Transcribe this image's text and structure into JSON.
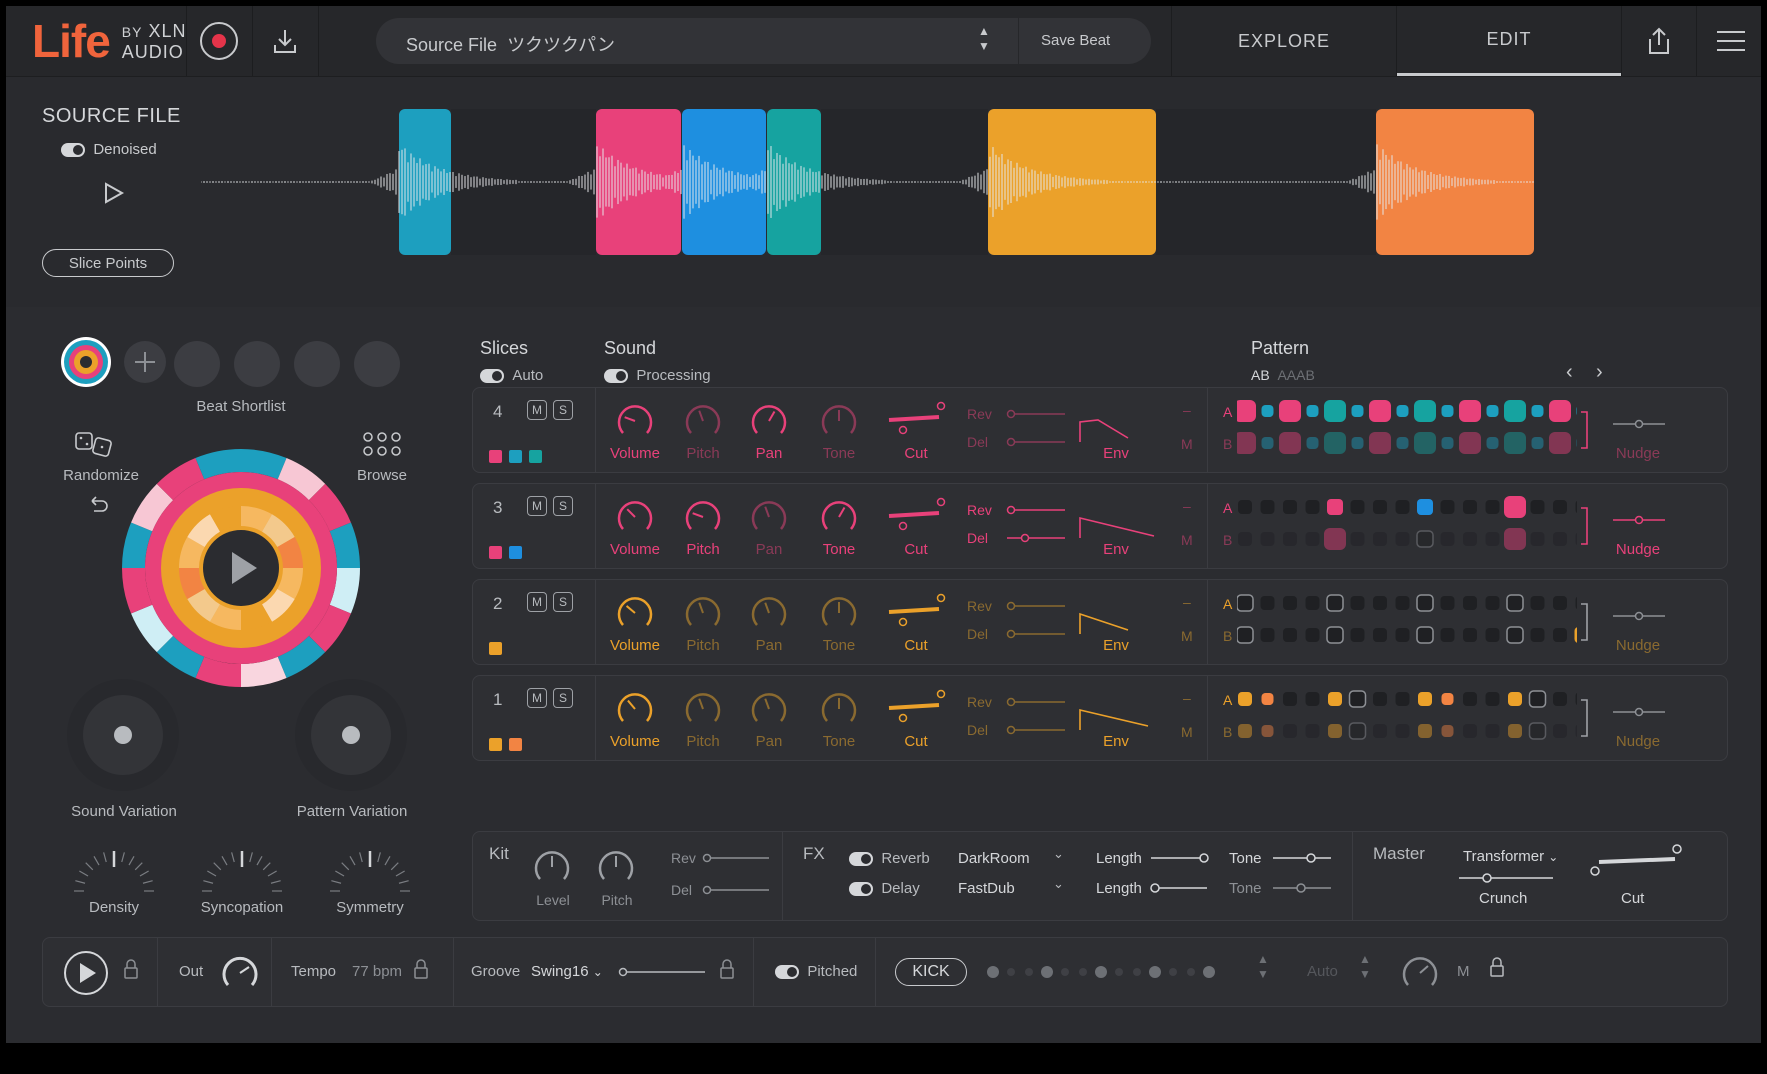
{
  "topbar": {
    "logo_text": "Life",
    "logo_by": "BY",
    "logo_xln": "XLN",
    "logo_audio": "AUDIO",
    "source_label": "Source File",
    "source_name": "ツクツクパン",
    "save_beat": "Save Beat",
    "tab_explore": "EXPLORE",
    "tab_edit": "EDIT"
  },
  "source": {
    "title": "SOURCE FILE",
    "denoised_label": "Denoised",
    "slice_points": "Slice Points",
    "slices": [
      {
        "color": "#1d9fbf"
      },
      {
        "color": "#e8417a"
      },
      {
        "color": "#1e8fe0"
      },
      {
        "color": "#16a3a0"
      },
      {
        "color": "#eba12a"
      },
      {
        "color": "#f28443"
      }
    ]
  },
  "left": {
    "beat_shortlist": "Beat Shortlist",
    "randomize": "Randomize",
    "browse": "Browse",
    "sound_variation": "Sound Variation",
    "pattern_variation": "Pattern Variation",
    "density": "Density",
    "syncopation": "Syncopation",
    "symmetry": "Symmetry"
  },
  "headers": {
    "slices": "Slices",
    "auto": "Auto",
    "sound": "Sound",
    "processing": "Processing",
    "pattern": "Pattern",
    "ab": "AB",
    "aaab": "AAAB"
  },
  "rows": [
    {
      "num": "4",
      "m": "M",
      "s": "S",
      "colors": [
        "#e8417a",
        "#1d9fbf",
        "#16a3a0"
      ],
      "accent": "#e8417a",
      "labels": {
        "volume": "Volume",
        "pitch": "Pitch",
        "pan": "Pan",
        "tone": "Tone",
        "cut": "Cut",
        "rev": "Rev",
        "del": "Del",
        "env": "Env",
        "m": "M",
        "nudge": "Nudge",
        "a": "A",
        "b": "B"
      }
    },
    {
      "num": "3",
      "m": "M",
      "s": "S",
      "colors": [
        "#e8417a",
        "#1e8fe0"
      ],
      "accent": "#e8417a",
      "labels": {
        "volume": "Volume",
        "pitch": "Pitch",
        "pan": "Pan",
        "tone": "Tone",
        "cut": "Cut",
        "rev": "Rev",
        "del": "Del",
        "env": "Env",
        "m": "M",
        "nudge": "Nudge",
        "a": "A",
        "b": "B"
      }
    },
    {
      "num": "2",
      "m": "M",
      "s": "S",
      "colors": [
        "#eba12a"
      ],
      "accent": "#eba12a",
      "labels": {
        "volume": "Volume",
        "pitch": "Pitch",
        "pan": "Pan",
        "tone": "Tone",
        "cut": "Cut",
        "rev": "Rev",
        "del": "Del",
        "env": "Env",
        "m": "M",
        "nudge": "Nudge",
        "a": "A",
        "b": "B"
      }
    },
    {
      "num": "1",
      "m": "M",
      "s": "S",
      "colors": [
        "#eba12a",
        "#f28443"
      ],
      "accent": "#eba12a",
      "labels": {
        "volume": "Volume",
        "pitch": "Pitch",
        "pan": "Pan",
        "tone": "Tone",
        "cut": "Cut",
        "rev": "Rev",
        "del": "Del",
        "env": "Env",
        "m": "M",
        "nudge": "Nudge",
        "a": "A",
        "b": "B"
      }
    }
  ],
  "kit": {
    "kit": "Kit",
    "level": "Level",
    "pitch": "Pitch",
    "rev": "Rev",
    "del": "Del",
    "fx": "FX",
    "reverb": "Reverb",
    "delay": "Delay",
    "reverb_type": "DarkRoom",
    "delay_type": "FastDub",
    "length": "Length",
    "tone": "Tone",
    "master": "Master",
    "transformer": "Transformer",
    "crunch": "Crunch",
    "cut": "Cut"
  },
  "bottom": {
    "out": "Out",
    "tempo": "Tempo",
    "tempo_value": "77 bpm",
    "groove": "Groove",
    "groove_value": "Swing16",
    "pitched": "Pitched",
    "kick": "KICK",
    "auto": "Auto",
    "m": "M"
  }
}
